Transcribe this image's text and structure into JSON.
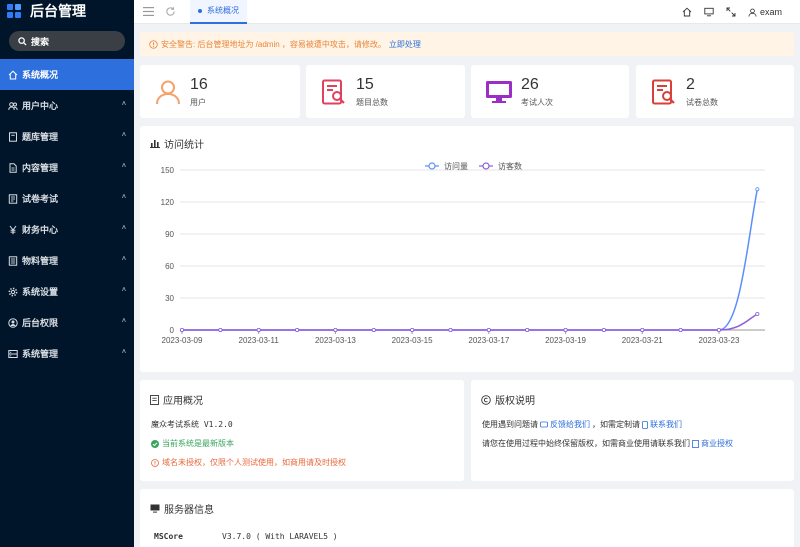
{
  "sidebar": {
    "brand": "后台管理",
    "search_label": "搜索",
    "items": [
      {
        "label": "系统概况",
        "icon": "home-icon",
        "active": true
      },
      {
        "label": "用户中心",
        "icon": "users-icon"
      },
      {
        "label": "题库管理",
        "icon": "book-icon"
      },
      {
        "label": "内容管理",
        "icon": "document-icon"
      },
      {
        "label": "试卷考试",
        "icon": "exam-icon"
      },
      {
        "label": "财务中心",
        "icon": "yen-icon"
      },
      {
        "label": "物料管理",
        "icon": "list-icon"
      },
      {
        "label": "系统设置",
        "icon": "gear-icon"
      },
      {
        "label": "后台权限",
        "icon": "user-circle-icon"
      },
      {
        "label": "系统管理",
        "icon": "server-icon"
      }
    ]
  },
  "topbar": {
    "tab_label": "系统概况",
    "username": "exam"
  },
  "alert": {
    "text": "安全警告: 后台管理地址为 /admin ，容易被遭中攻击，请修改。",
    "link": "立即处理"
  },
  "stats": [
    {
      "value": "16",
      "label": "用户",
      "color": "#f4a26a"
    },
    {
      "value": "15",
      "label": "题目总数",
      "color": "#e0425e"
    },
    {
      "value": "26",
      "label": "考试人次",
      "color": "#9b2fc5"
    },
    {
      "value": "2",
      "label": "试卷总数",
      "color": "#d8403a"
    }
  ],
  "chart": {
    "title": "访问统计"
  },
  "chart_data": {
    "type": "line",
    "x": [
      "2023-03-09",
      "2023-03-10",
      "2023-03-11",
      "2023-03-12",
      "2023-03-13",
      "2023-03-14",
      "2023-03-15",
      "2023-03-16",
      "2023-03-17",
      "2023-03-18",
      "2023-03-19",
      "2023-03-20",
      "2023-03-21",
      "2023-03-22",
      "2023-03-23",
      "2023-03-24"
    ],
    "xticks": [
      "2023-03-09",
      "2023-03-11",
      "2023-03-13",
      "2023-03-15",
      "2023-03-17",
      "2023-03-19",
      "2023-03-21",
      "2023-03-23"
    ],
    "yticks": [
      0,
      30,
      60,
      90,
      120,
      150
    ],
    "ylim": [
      0,
      150
    ],
    "series": [
      {
        "name": "访问量",
        "color": "#5b8ff9",
        "values": [
          0,
          0,
          0,
          0,
          0,
          0,
          0,
          0,
          0,
          0,
          0,
          0,
          0,
          0,
          0,
          132
        ]
      },
      {
        "name": "访客数",
        "color": "#8e5cd9",
        "values": [
          0,
          0,
          0,
          0,
          0,
          0,
          0,
          0,
          0,
          0,
          0,
          0,
          0,
          0,
          0,
          15
        ]
      }
    ],
    "legend": "top-center",
    "grid": true
  },
  "app_overview": {
    "title": "应用概况",
    "version_line": "魔众考试系统 V1.2.0",
    "latest": "当前系统是最新版本",
    "warning": "域名未授权，仅限个人测试使用，如商用请及时授权"
  },
  "copyright": {
    "title": "版权说明",
    "line1_prefix": "使用遇到问题请",
    "line1_link1": "反馈给我们",
    "line1_mid": "，如需定制请",
    "line1_link2": "联系我们",
    "line2_prefix": "请您在使用过程中始终保留版权，如需商业使用请联系我们",
    "line2_link": "商业授权"
  },
  "server": {
    "title": "服务器信息",
    "key": "MSCore",
    "value": "V3.7.0 ( With LARAVEL5 )"
  }
}
